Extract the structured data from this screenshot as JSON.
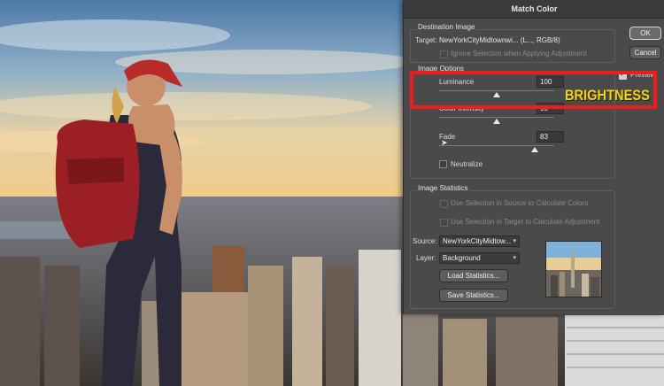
{
  "dialog": {
    "title": "Match Color",
    "destination": {
      "group_title": "Destination Image",
      "target_label": "Target:",
      "target_value": "NewYorkCityMidtownwi... (L..., RGB/8)",
      "ignore_selection_label": "Ignore Selection when Applying Adjustment"
    },
    "image_options": {
      "group_title": "Image Options",
      "luminance": {
        "label": "Luminance",
        "value": "100",
        "slider_fraction": 0.5
      },
      "color_intensity": {
        "label": "Color Intensity",
        "value": "99",
        "slider_fraction": 0.5
      },
      "fade": {
        "label": "Fade",
        "value": "83",
        "slider_fraction": 0.83
      },
      "neutralize_label": "Neutralize"
    },
    "image_statistics": {
      "group_title": "Image Statistics",
      "use_source_label": "Use Selection in Source to Calculate Colors",
      "use_target_label": "Use Selection in Target to Calculate Adjustment",
      "source_label": "Source:",
      "source_value": "NewYorkCityMidtow...",
      "layer_label": "Layer:",
      "layer_value": "Background",
      "load_button": "Load Statistics...",
      "save_button": "Save Statistics..."
    },
    "buttons": {
      "ok": "OK",
      "cancel": "Cancel"
    },
    "preview": {
      "label": "Preview",
      "checked": true
    }
  },
  "overlay": {
    "annotation_text": "BRIGHTNESS",
    "annotation_color": "#f3d31b",
    "highlight_color": "#ee1c1c"
  }
}
